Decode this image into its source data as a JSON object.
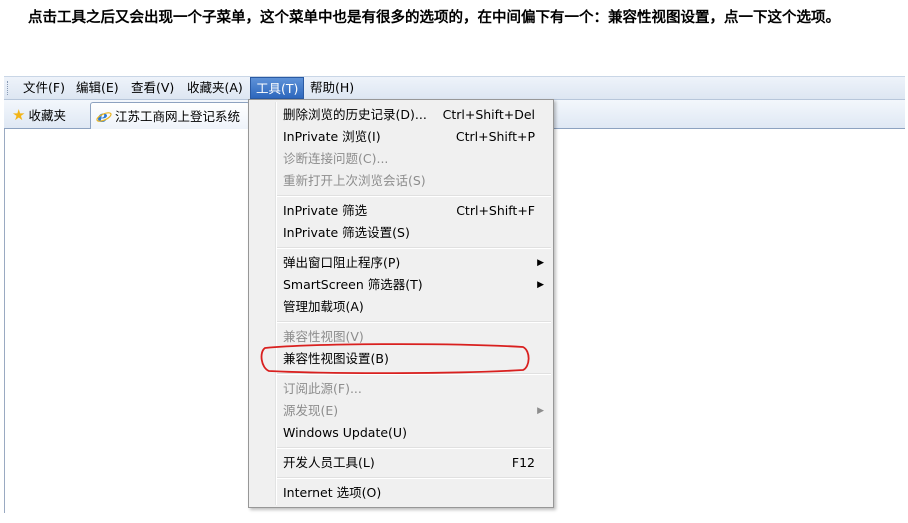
{
  "caption": {
    "text": "点击工具之后又会出现一个子菜单，这个菜单中也是有很多的选项的，在中间偏下有一个：兼容性视图设置，点一下这个选项。"
  },
  "menubar": {
    "items": [
      {
        "label": "文件(F)"
      },
      {
        "label": "编辑(E)"
      },
      {
        "label": "查看(V)"
      },
      {
        "label": "收藏夹(A)"
      },
      {
        "label": "工具(T)"
      },
      {
        "label": "帮助(H)"
      }
    ],
    "active": "工具(T)"
  },
  "favbar": {
    "favorites_label": "收藏夹",
    "tab_title": "江苏工商网上登记系统"
  },
  "tools_menu": {
    "items": [
      {
        "label": "删除浏览的历史记录(D)...",
        "shortcut": "Ctrl+Shift+Del",
        "enabled": true
      },
      {
        "label": "InPrivate 浏览(I)",
        "shortcut": "Ctrl+Shift+P",
        "enabled": true
      },
      {
        "label": "诊断连接问题(C)...",
        "enabled": false
      },
      {
        "label": "重新打开上次浏览会话(S)",
        "enabled": false
      },
      {
        "label": "InPrivate 筛选",
        "shortcut": "Ctrl+Shift+F",
        "enabled": true
      },
      {
        "label": "InPrivate 筛选设置(S)",
        "enabled": true
      },
      {
        "label": "弹出窗口阻止程序(P)",
        "submenu": true,
        "enabled": true
      },
      {
        "label": "SmartScreen 筛选器(T)",
        "submenu": true,
        "enabled": true
      },
      {
        "label": "管理加载项(A)",
        "enabled": true
      },
      {
        "label": "兼容性视图(V)",
        "enabled": false
      },
      {
        "label": "兼容性视图设置(B)",
        "enabled": true
      },
      {
        "label": "订阅此源(F)...",
        "enabled": false
      },
      {
        "label": "源发现(E)",
        "submenu": true,
        "enabled": false
      },
      {
        "label": "Windows Update(U)",
        "enabled": true
      },
      {
        "label": "开发人员工具(L)",
        "shortcut": "F12",
        "enabled": true
      },
      {
        "label": "Internet 选项(O)",
        "enabled": true
      }
    ]
  },
  "colors": {
    "active_menu_bg": "#2d67bd",
    "highlight_ring": "#d9201f",
    "disabled_text": "#8d8d8d"
  }
}
